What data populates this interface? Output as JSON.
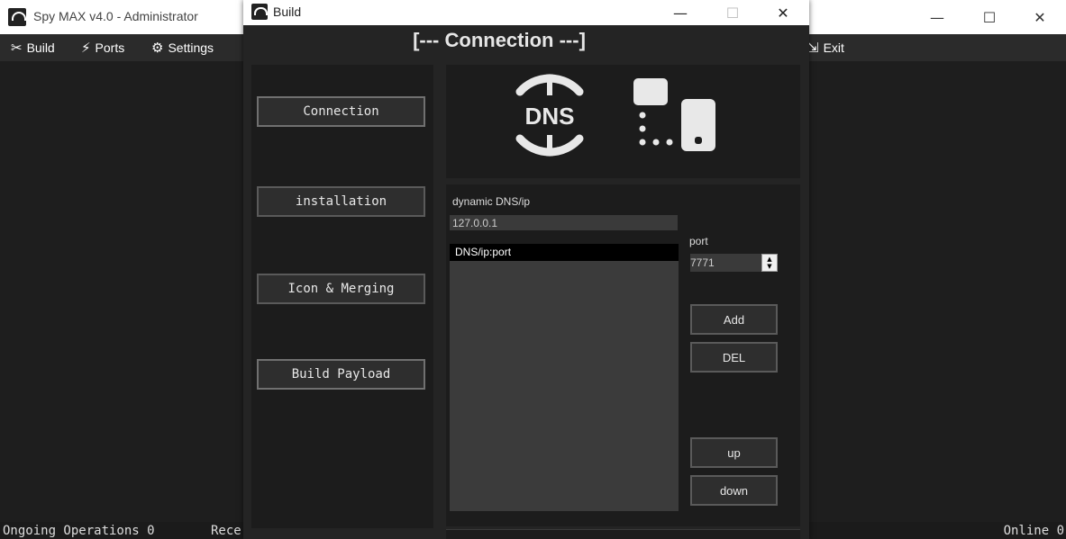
{
  "main_window": {
    "title": "Spy MAX v4.0 - Administrator",
    "controls": {
      "minimize": "—",
      "maximize": "☐",
      "close": "✕"
    }
  },
  "menubar": {
    "items": [
      {
        "label": "Build",
        "icon": "tools-icon",
        "glyph": "✂"
      },
      {
        "label": "Ports",
        "icon": "plug-icon",
        "glyph": "⚡"
      },
      {
        "label": "Settings",
        "icon": "gear-icon",
        "glyph": "⚙"
      },
      {
        "label": "Exit",
        "icon": "exit-icon",
        "glyph": "⇲"
      }
    ]
  },
  "statusbar": {
    "ongoing": "Ongoing Operations 0",
    "received": "Rece",
    "online": "Online 0"
  },
  "dialog": {
    "title": "Build",
    "controls": {
      "minimize": "—",
      "maximize": "☐",
      "close": "✕"
    },
    "heading": "[--- Connection ---]",
    "nav": [
      {
        "label": "Connection"
      },
      {
        "label": "installation"
      },
      {
        "label": "Icon & Merging"
      },
      {
        "label": "Build Payload"
      }
    ],
    "banner": {
      "dns_text": "DNS"
    },
    "form": {
      "dns_label": "dynamic DNS/ip",
      "dns_value": "127.0.0.1",
      "list_header": "DNS/ip:port",
      "port_label": "port",
      "port_value": "7771",
      "spin_up": "▲",
      "spin_down": "▼",
      "add_label": "Add",
      "del_label": "DEL",
      "up_label": "up",
      "down_label": "down"
    }
  }
}
